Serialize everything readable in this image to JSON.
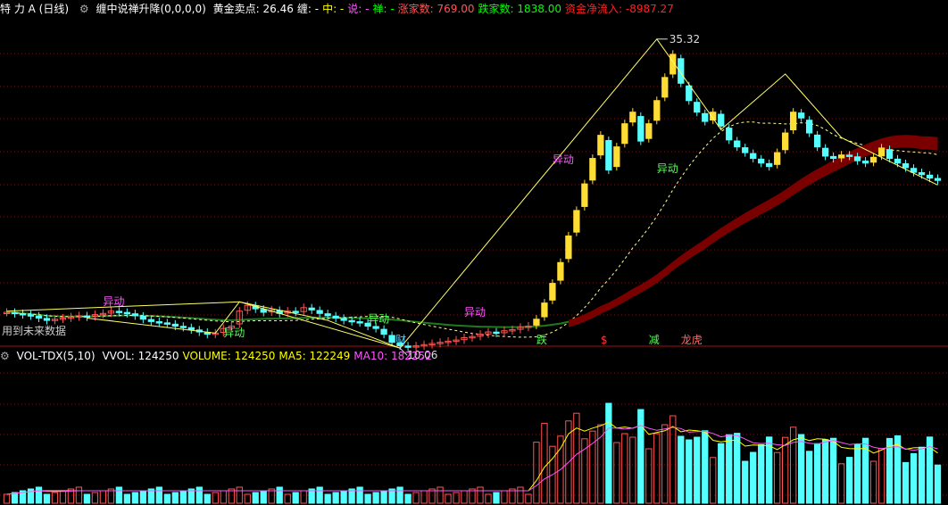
{
  "main_header": {
    "title": "特 力 A (日线)",
    "indicator": "缠中说禅升降(0,0,0,0)",
    "items": [
      {
        "label": "黄金卖点:",
        "value": "26.46",
        "color": "#ffffff"
      },
      {
        "label": "缠:",
        "value": "-",
        "color": "#ffffff"
      },
      {
        "label": "中:",
        "value": "-",
        "color": "#ffff00"
      },
      {
        "label": "说:",
        "value": "-",
        "color": "#ff55ff"
      },
      {
        "label": "禅:",
        "value": "-",
        "color": "#00ff00"
      },
      {
        "label": "涨家数:",
        "value": "769.00",
        "color": "#ff5555"
      },
      {
        "label": "跌家数:",
        "value": "1838.00",
        "color": "#00ff00"
      },
      {
        "label": "资金净流入:",
        "value": "-8987.27",
        "color": "#ff2222"
      }
    ]
  },
  "volume_header": {
    "indicator": "VOL-TDX(5,10)",
    "items": [
      {
        "label": "VVOL:",
        "value": "124250",
        "color": "#ffffff"
      },
      {
        "label": "VOLUME:",
        "value": "124250",
        "color": "#ffff00"
      },
      {
        "label": "MA5:",
        "value": "122249",
        "color": "#ffff00"
      },
      {
        "label": "MA10:",
        "value": "182252",
        "color": "#ff55ff"
      }
    ]
  },
  "footer_note": "用到未来数据",
  "chart_data": [
    {
      "type": "candlestick",
      "price_range": [
        9.0,
        37.0
      ],
      "closes": [
        11.7,
        11.6,
        11.5,
        11.4,
        11.2,
        11.0,
        11.1,
        11.2,
        11.3,
        11.4,
        11.3,
        11.5,
        11.6,
        11.8,
        11.7,
        11.6,
        11.4,
        11.1,
        10.9,
        10.8,
        10.7,
        10.5,
        10.4,
        10.2,
        10.0,
        9.8,
        9.9,
        10.3,
        10.5,
        11.8,
        12.3,
        12.0,
        11.7,
        11.9,
        11.6,
        11.8,
        11.7,
        12.1,
        11.9,
        11.6,
        11.4,
        11.2,
        11.0,
        10.9,
        10.8,
        10.5,
        10.3,
        9.8,
        9.1,
        8.8,
        8.7,
        8.8,
        8.9,
        9.0,
        9.1,
        9.2,
        9.3,
        9.5,
        9.6,
        9.8,
        10.0,
        9.9,
        10.1,
        10.2,
        10.4,
        10.5,
        11.1,
        12.5,
        14.2,
        16.0,
        18.3,
        20.5,
        22.8,
        25.0,
        27.0,
        24.0,
        26.0,
        28.0,
        29.0,
        26.5,
        28.0,
        30.0,
        32.0,
        34.0,
        31.5,
        30.0,
        29.0,
        28.2,
        29.0,
        27.8,
        26.6,
        26.0,
        25.5,
        25.0,
        24.6,
        24.3,
        25.5,
        27.2,
        29.0,
        28.5,
        27.2,
        26.0,
        25.2,
        25.0,
        25.3,
        25.2,
        24.8,
        24.6,
        25.1,
        25.9,
        25.0,
        24.6,
        24.2,
        23.8,
        23.6,
        23.3,
        23.1
      ],
      "annotations": [
        "35.32",
        "10.06",
        "异动",
        "财",
        "跌",
        "$",
        "减",
        "龙虎"
      ]
    },
    {
      "type": "bar",
      "series": [
        "VVOL",
        "MA5",
        "MA10"
      ]
    }
  ],
  "colors": {
    "up": "#ff5555",
    "down": "#55ffff",
    "hollow_up": "#ffdd33",
    "ma5": "#ffff00",
    "ma10": "#ff55ff",
    "grid": "#7a1010"
  }
}
